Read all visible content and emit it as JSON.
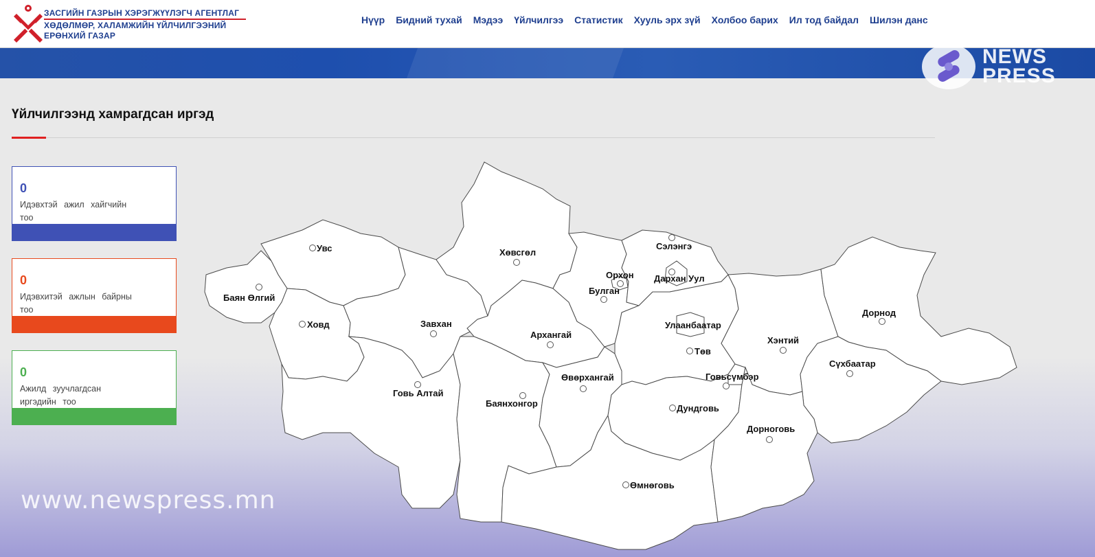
{
  "org": {
    "line1": "ЗАСГИЙН ГАЗРЫН ХЭРЭГЖҮҮЛЭГЧ АГЕНТЛАГ",
    "line2": "ХӨДӨЛМӨР, ХАЛАМЖИЙН ҮЙЛЧИЛГЭЭНИЙ",
    "line3": "ЕРӨНХИЙ ГАЗАР"
  },
  "nav": [
    {
      "label": "Нүүр"
    },
    {
      "label": "Бидний тухай"
    },
    {
      "label": "Мэдээ"
    },
    {
      "label": "Үйлчилгээ"
    },
    {
      "label": "Статистик"
    },
    {
      "label": "Хууль эрх зүй"
    },
    {
      "label": "Холбоо барих"
    },
    {
      "label": "Ил тод байдал"
    },
    {
      "label": "Шилэн данс"
    }
  ],
  "newspress": {
    "line1": "NEWS",
    "line2": "PRESS"
  },
  "section": {
    "title": "Үйлчилгээнд хамрагдсан иргэд"
  },
  "stats": [
    {
      "value": "0",
      "label": "Идэвхтэй ажил хайгчийн тоо",
      "color": "#3f51b5"
    },
    {
      "value": "0",
      "label": "Идэвхитэй ажлын байрны тоо",
      "color": "#e8491d"
    },
    {
      "value": "0",
      "label": "Ажилд зуучлагдсан иргэдийн тоо",
      "color": "#4caf50"
    }
  ],
  "provinces": {
    "uvs": "Увс",
    "bayan_olgii": "Баян Өлгий",
    "khovd": "Ховд",
    "zavkhan": "Завхан",
    "govi_altai": "Говь Алтай",
    "khovsgol": "Хөвсгөл",
    "arkhangai": "Архангай",
    "bayankhongor": "Баянхонгор",
    "ovorkhangai": "Өвөрхангай",
    "umnugovi": "Өмнөговь",
    "orkhon": "Орхон",
    "bulgan": "Булган",
    "selenge": "Сэлэнгэ",
    "darkhan_uul": "Дархан Уул",
    "ulaanbaatar": "Улаанбаатар",
    "tov": "Төв",
    "govisumber": "Говьсүмбэр",
    "dundgovi": "Дундговь",
    "dornogovi": "Дорноговь",
    "khentii": "Хэнтий",
    "dornod": "Дорнод",
    "sukhbaatar": "Сүхбаатар"
  },
  "watermark": "www.newspress.mn"
}
